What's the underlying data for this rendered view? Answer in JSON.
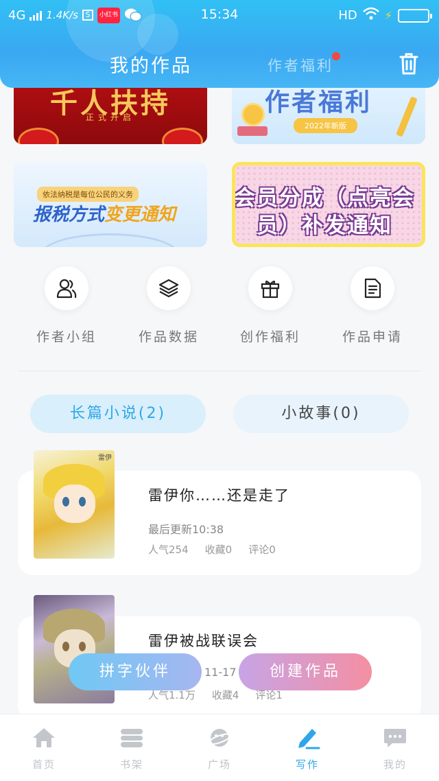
{
  "status_bar": {
    "network": "4G",
    "speed": "1.4K/s",
    "box_char": "S",
    "app_badge": "小红书",
    "time": "15:34",
    "hd": "HD"
  },
  "header": {
    "title": "我的作品",
    "tab_welfare": "作者福利"
  },
  "banners": {
    "b1_title": "千人扶持",
    "b1_sub": "正式开启",
    "b2_title": "作者福利",
    "b2_pill": "2022年新版",
    "b3_small": "依法纳税是每位公民的义务",
    "b3_title_a": "报税方式",
    "b3_title_b": "变更通知",
    "b4_title": "会员分成（点亮会员）补发通知"
  },
  "quick_entries": [
    {
      "label": "作者小组",
      "icon": "people-icon"
    },
    {
      "label": "作品数据",
      "icon": "layers-icon"
    },
    {
      "label": "创作福利",
      "icon": "gift-icon"
    },
    {
      "label": "作品申请",
      "icon": "document-icon"
    }
  ],
  "tabs": {
    "novel": "长篇小说(2)",
    "story": "小故事(0)"
  },
  "works": [
    {
      "title": "雷伊你……还是走了",
      "update": "最后更新10:38",
      "popularity": "人气254",
      "favorites": "收藏0",
      "comments": "评论0",
      "cover_tag": "雷伊"
    },
    {
      "title": "雷伊被战联误会",
      "update": "11-17",
      "popularity": "人气1.1万",
      "favorites": "收藏4",
      "comments": "评论1"
    }
  ],
  "buttons": {
    "partner": "拼字伙伴",
    "create": "创建作品"
  },
  "bottom_nav": [
    {
      "label": "首页",
      "icon": "home-icon"
    },
    {
      "label": "书架",
      "icon": "bookshelf-icon"
    },
    {
      "label": "广场",
      "icon": "planet-icon"
    },
    {
      "label": "写作",
      "icon": "pen-icon"
    },
    {
      "label": "我的",
      "icon": "chat-bubble-icon"
    }
  ],
  "colors": {
    "accent": "#2ea6e8",
    "header": "#3aa8f2",
    "notify_dot": "#f04a3d"
  }
}
